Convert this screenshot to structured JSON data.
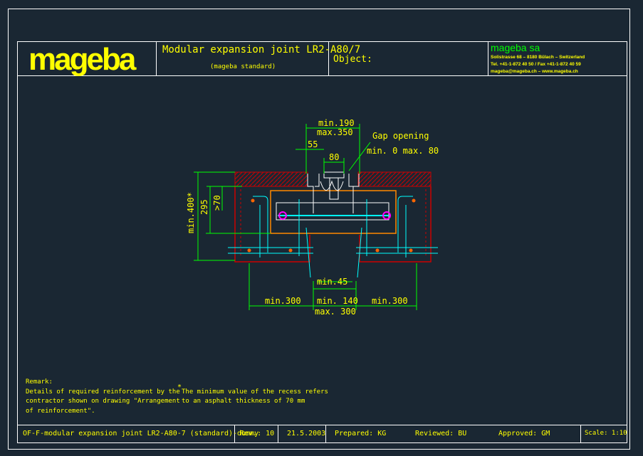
{
  "header": {
    "logo": "mageba",
    "title": "Modular expansion joint LR2-A80/7",
    "subtitle": "(mageba standard)",
    "object_label": "Object:",
    "company": "mageba sa",
    "address_line1": "Solistrasse 68 – 8180 Bülach – Switzerland",
    "address_line2": "Tel. +41-1-872 40 50 / Fax +41-1-872 40 59",
    "address_line3": "mageba@mageba.ch – www.mageba.ch"
  },
  "drawing": {
    "dim_min190": "min.190",
    "dim_max350": "max.350",
    "gap_opening": "Gap opening",
    "gap_range": "min. 0   max. 80",
    "dim_55": "55",
    "dim_80": "80",
    "dim_min400": "min.400*",
    "dim_295": "295",
    "dim_70": ">70",
    "dim_min45": "min.45",
    "dim_min300_left": "min.300",
    "dim_min140": "min. 140",
    "dim_min300_right": "min.300",
    "dim_max300": "max. 300"
  },
  "remarks": {
    "heading": "Remark:",
    "line1": "Details of required reinforcement by the",
    "line2": "contractor shown on drawing \"Arrangement",
    "line3": "of reinforcement\".",
    "star": "*",
    "note1": "The minimum value of the recess refers",
    "note2": "to an asphalt thickness of 70 mm"
  },
  "footer": {
    "drawing_id": "OF-F-modular expansion joint LR2-A80-7 (standard)-dummy",
    "rev": "Rev.: 10",
    "date": "21.5.2003",
    "prepared": "Prepared: KG",
    "reviewed": "Reviewed:  BU",
    "approved": "Approved:  GM",
    "scale": "Scale:  1:10"
  },
  "colors": {
    "background": "#1a2733",
    "lines": "#ffffff",
    "text": "#ffff00",
    "dimension": "#00ff00",
    "concrete": "#cc0000",
    "steel": "#00ffff",
    "anchor": "#ff00ff"
  }
}
